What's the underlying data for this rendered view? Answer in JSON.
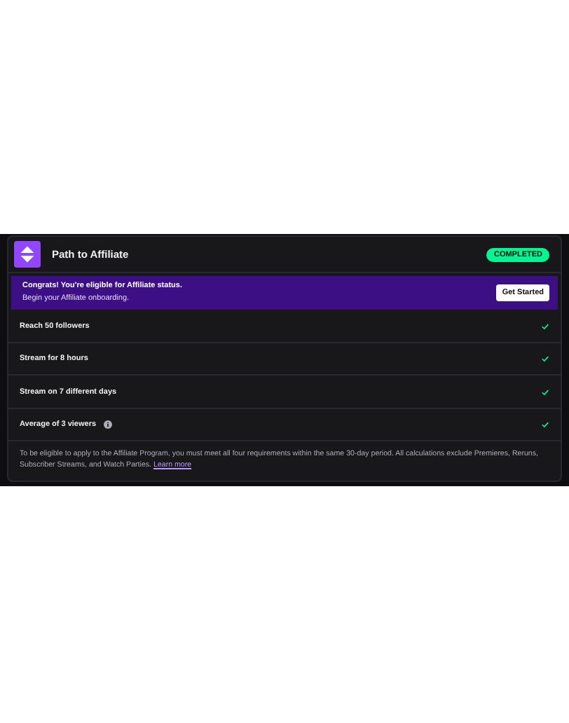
{
  "header": {
    "title": "Path to Affiliate",
    "badge": "COMPLETED"
  },
  "banner": {
    "headline": "Congrats! You're eligible for Affiliate status.",
    "subline": "Begin your Affiliate onboarding.",
    "button": "Get Started"
  },
  "requirements": [
    {
      "label": "Reach 50 followers",
      "completed": true,
      "info": false
    },
    {
      "label": "Stream for 8 hours",
      "completed": true,
      "info": false
    },
    {
      "label": "Stream on 7 different days",
      "completed": true,
      "info": false
    },
    {
      "label": "Average of 3 viewers",
      "completed": true,
      "info": true
    }
  ],
  "footer": {
    "text": "To be eligible to apply to the Affiliate Program, you must meet all four requirements within the same 30-day period. All calculations exclude Premieres, Reruns, Subscriber Streams, and Watch Parties.",
    "link": "Learn more"
  }
}
